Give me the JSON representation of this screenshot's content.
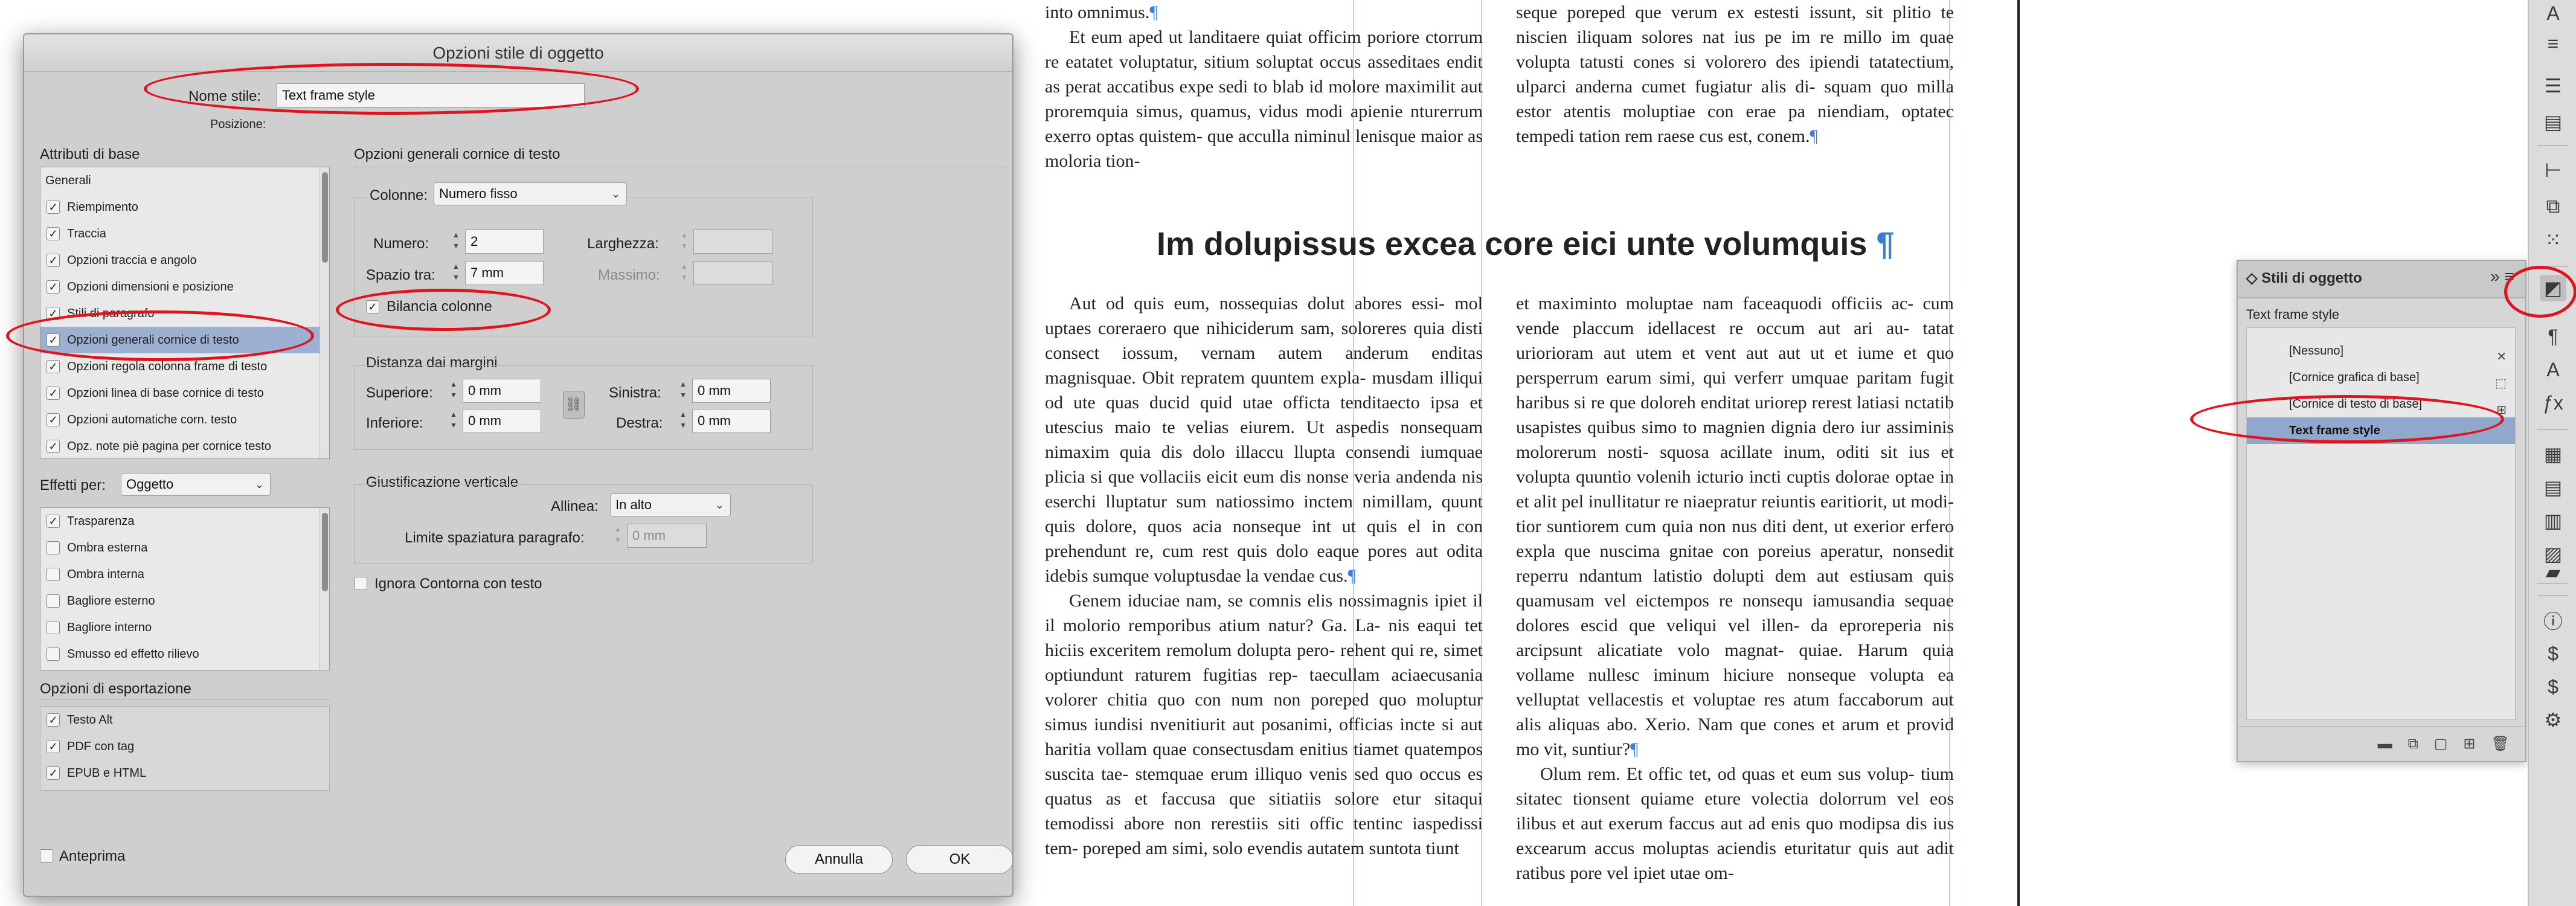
{
  "dialog": {
    "title": "Opzioni stile di oggetto",
    "style_name_label": "Nome stile:",
    "style_name_value": "Text frame style",
    "position_label": "Posizione:",
    "basic_attributes_heading": "Attributi di base",
    "attributes_list": [
      {
        "label": "Generali",
        "checked": null
      },
      {
        "label": "Riempimento",
        "checked": true
      },
      {
        "label": "Traccia",
        "checked": true
      },
      {
        "label": "Opzioni traccia e angolo",
        "checked": true
      },
      {
        "label": "Opzioni dimensioni e posizione",
        "checked": true
      },
      {
        "label": "Stili di paragrafo",
        "checked": true
      },
      {
        "label": "Opzioni generali cornice di testo",
        "checked": true,
        "selected": true
      },
      {
        "label": "Opzioni regola colonna frame di testo",
        "checked": true
      },
      {
        "label": "Opzioni linea di base cornice di testo",
        "checked": true
      },
      {
        "label": "Opzioni automatiche corn. testo",
        "checked": true
      },
      {
        "label": "Opz. note piè pagina per cornice testo",
        "checked": true
      }
    ],
    "effects_for_label": "Effetti per:",
    "effects_for_value": "Oggetto",
    "effects_list": [
      {
        "label": "Trasparenza",
        "checked": true
      },
      {
        "label": "Ombra esterna",
        "checked": false
      },
      {
        "label": "Ombra interna",
        "checked": false
      },
      {
        "label": "Bagliore esterno",
        "checked": false
      },
      {
        "label": "Bagliore interno",
        "checked": false
      },
      {
        "label": "Smusso ed effetto rilievo",
        "checked": false
      }
    ],
    "export_heading": "Opzioni di esportazione",
    "export_list": [
      {
        "label": "Testo Alt",
        "checked": true
      },
      {
        "label": "PDF con tag",
        "checked": true
      },
      {
        "label": "EPUB e HTML",
        "checked": true
      }
    ],
    "preview_label": "Anteprima",
    "preview_checked": false,
    "cancel_label": "Annulla",
    "ok_label": "OK",
    "right": {
      "section_title": "Opzioni generali cornice di testo",
      "columns_label": "Colonne:",
      "columns_value": "Numero fisso",
      "number_label": "Numero:",
      "number_value": "2",
      "width_label": "Larghezza:",
      "gutter_label": "Spazio tra:",
      "gutter_value": "7 mm",
      "maximum_label": "Massimo:",
      "balance_label": "Bilancia colonne",
      "balance_checked": true,
      "inset_heading": "Distanza dai margini",
      "top_label": "Superiore:",
      "top_value": "0 mm",
      "bottom_label": "Inferiore:",
      "bottom_value": "0 mm",
      "left_label": "Sinistra:",
      "left_value": "0 mm",
      "right_label": "Destra:",
      "right_value": "0 mm",
      "vertical_heading": "Giustificazione verticale",
      "align_label": "Allinea:",
      "align_value": "In alto",
      "para_spacing_label": "Limite spaziatura paragrafo:",
      "para_spacing_value": "0 mm",
      "ignore_wrap_label": "Ignora Contorna con testo",
      "ignore_wrap_checked": false
    }
  },
  "document": {
    "heading": "Im dolupissus excea core eici unte volumquis",
    "pilcrow": "¶",
    "top_left_line1": "into omnimus.",
    "top_left_para": "Et eum aped ut landitaere quiat officim poriore ctorrum re eatatet voluptatur, sitium soluptat occus asseditaes endit as perat accatibus expe sedi to blab id molore maximilit aut proremquia simus, quamus, vidus modi apienie nturerrum exerro optas quistem- que acculla niminul lenisque maior as moloria tion-",
    "top_right_para": "seque poreped que verum ex estesti issunt, sit plitio te niscien iliquam solores nat ius pe im re millo im quae volupta tatusti cones si volorero des ipiendi tatatectium, ulparci anderna cumet fugiatur alis di- squam quo milla estor atentis moluptiae con erae pa niendiam, optatec tempedi tation rem raese cus est, conem.",
    "left_col_para1": "Aut od quis eum, nossequias dolut abores essi- mol uptaes coreraero que nihiciderum sam, soloreres quia disti consect iossum, vernam autem anderum enditas magnisquae. Obit repratem quuntem expla- musdam illiqui od ute quas ducid quid utae officta tenditaecto ipsa et utescius maio te velias eiurem. Ut aspedis nonsequam nimaxim quia dis dolo illaccu llupta consendi iumquae plicia si que vollaciis eicit eum dis nonse veria andenda nis eserchi lluptatur sum natiossimo inctem nimillam, quunt quis dolore, quos acia nonseque int ut quis el in con prehendunt re, cum rest quis dolo eaque pores aut odita idebis sumque voluptusdae la vendae cus.",
    "left_col_para2": "Genem iduciae nam, se comnis elis nossimagnis ipiet il il molorio remporibus atium natur? Ga. La- nis eaqui tet hiciis exceritem remolum dolupta pero- rehent qui re, simet optiundunt raturem fugitias rep- taecullam aciaecusania volorer chitia quo con num non poreped quo moluptur simus iundisi nvenitiurit aut posanimi, officias incte si aut haritia vollam quae consectusdam enitius tiamet quatempos suscita tae- stemquae erum illiquo venis sed quo occus es quatus as et faccusa que sitiatiis solore etur sitaqui temodissi abore non rerestiis siti offic tentinc iaspedissi tem- poreped am simi, solo evendis autatem suntota tiunt",
    "right_col_para1": "et maximinto moluptae nam faceaquodi officiis ac- cum vende placcum idellacest re occum aut ari au- tatat uriorioram aut utem et vent aut aut ut et iume et quo persperrum earum simi, qui verferr umquae paritam fugit haribus si re que doloreh enditat uriorep rerest latiasi nctatib usapistes quibus simo to magnien dignia dero iur assiminis molorerum nosti- squosa acillate inum, oditi sit ius et volupta quuntio volenih icturio incti cuptis dolorae optae in et alit pel inullitatur re niaepratur reiuntis earitiorit, ut modi- tior suntiorem cum quia non nus diti dent, ut exerior erfero expla que nuscima gnitae con poreius aperatur, nonsedit reperru ndantum latistio dolupti dem aut estiusam quis quamusam vel eictempos re nonsequ iamusandia sequae dolores escid que veliqui vel illen- da eproreperia nis arcipsunt alicatiate volo magnat- quiae. Harum quia vollame nullesc iminum hiciure nonseque volupta ea velluptat vellacestis et voluptae res atum faccaborum aut alis aliquas abo. Xerio. Nam que cones et arum et provid mo vit, suntiur?",
    "right_col_para2": "Olum rem. Et offic tet, od quas et eum sus volup- tium sitatec tionsent quiame eture volectia dolorrum vel eos ilibus et aut exerum faccus aut ad enis quo modipsa dis ius excearum accus moluptas aciendis eturitatur quis aut adit ratibus pore vel ipiet utae om-"
  },
  "object_styles_panel": {
    "tab_title": "Stili di oggetto",
    "current_style": "Text frame style",
    "styles": [
      {
        "label": "[Nessuno]",
        "icon": "x-mark-icon"
      },
      {
        "label": "[Cornice grafica di base]",
        "icon": "graphic-frame-icon"
      },
      {
        "label": "[Cornice di testo di base]",
        "icon": "text-frame-icon"
      },
      {
        "label": "Text frame style",
        "selected": true
      }
    ]
  },
  "colors": {
    "annotation_red": "#e0141e",
    "selection_blue": "#9cb0d2",
    "pilcrow_blue": "#3b7fd0"
  }
}
